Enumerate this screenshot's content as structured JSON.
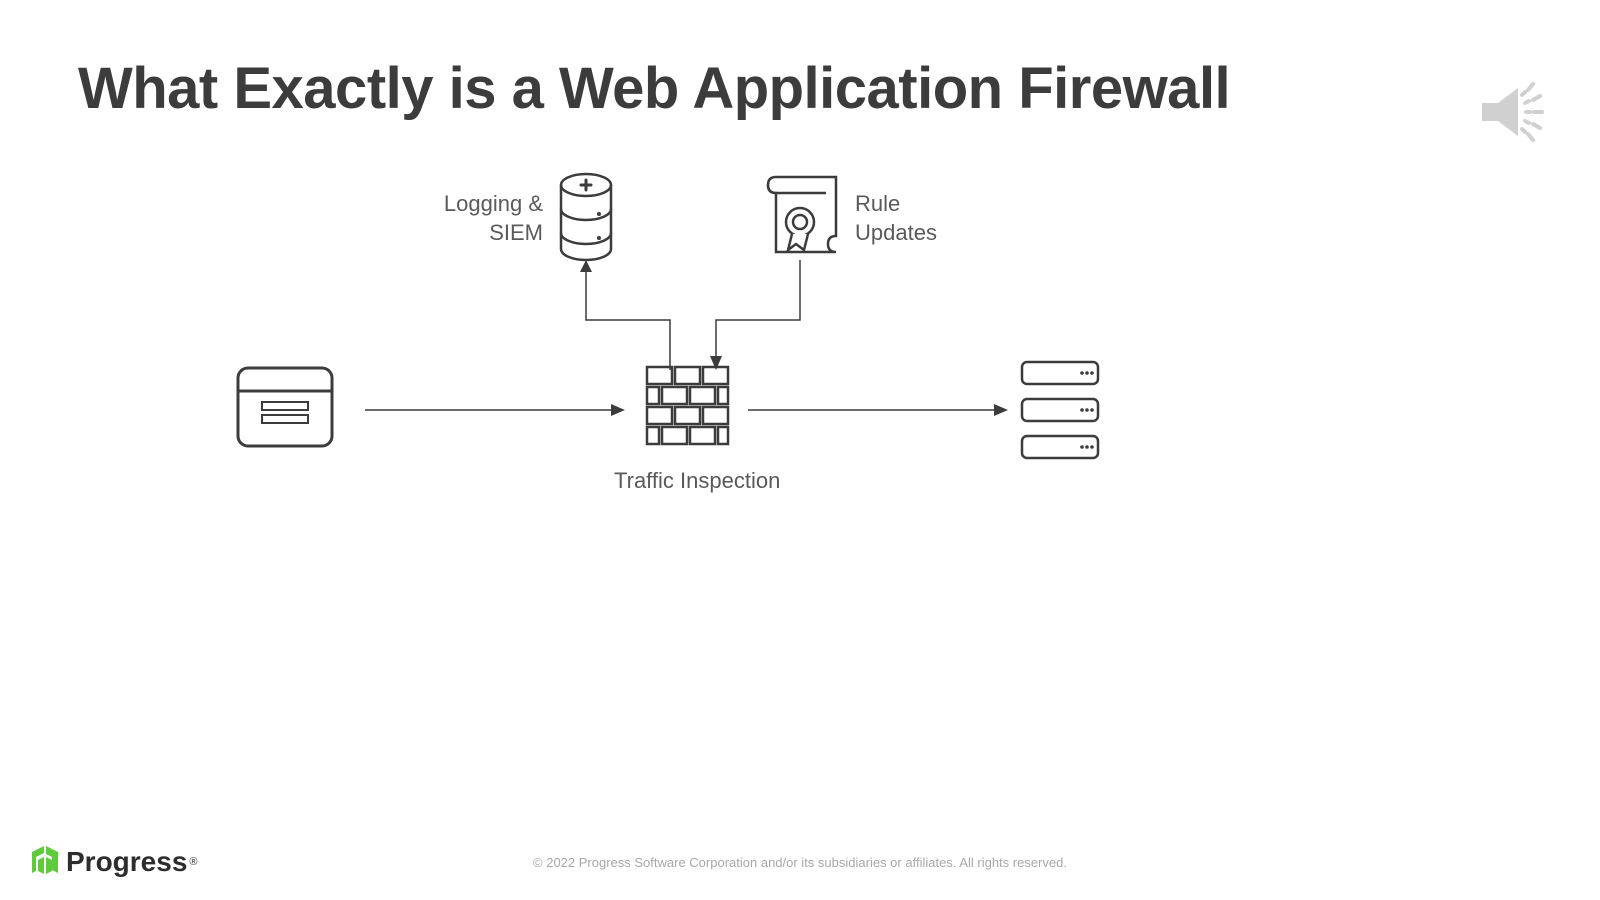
{
  "title": "What Exactly is a Web Application Firewall",
  "labels": {
    "logging": "Logging &\nSIEM",
    "rules": "Rule\nUpdates",
    "traffic": "Traffic Inspection"
  },
  "footer": {
    "brand": "Progress",
    "registered": "®",
    "copyright": "© 2022 Progress Software Corporation and/or its subsidiaries or affiliates. All rights reserved."
  },
  "brand_color": "#5ecb3e"
}
